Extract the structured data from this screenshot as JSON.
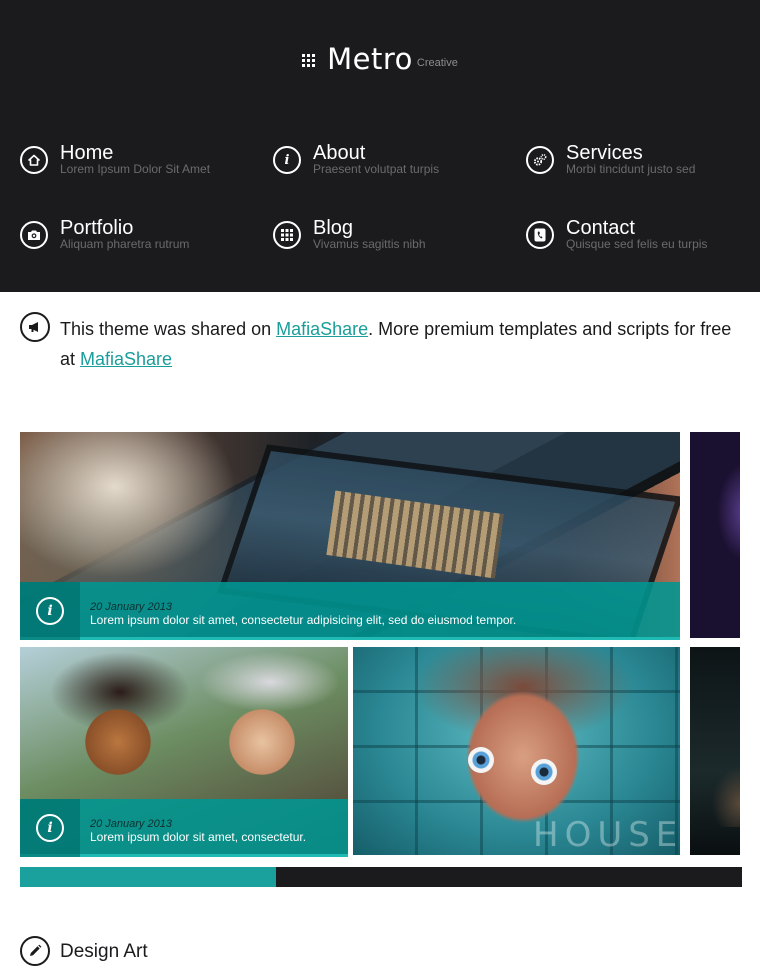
{
  "brand": {
    "title": "Metro",
    "subtitle": "Creative",
    "icon": "grid-icon"
  },
  "nav": {
    "items": [
      {
        "label": "Home",
        "desc": "Lorem Ipsum Dolor Sit Amet",
        "icon": "home-icon"
      },
      {
        "label": "About",
        "desc": "Praesent volutpat turpis",
        "icon": "info-icon"
      },
      {
        "label": "Services",
        "desc": "Morbi tincidunt justo sed",
        "icon": "gears-icon"
      },
      {
        "label": "Portfolio",
        "desc": "Aliquam pharetra rutrum",
        "icon": "camera-icon"
      },
      {
        "label": "Blog",
        "desc": "Vivamus sagittis nibh",
        "icon": "grid-icon"
      },
      {
        "label": "Contact",
        "desc": "Quisque sed felis eu turpis",
        "icon": "phone-icon"
      }
    ]
  },
  "notice": {
    "icon": "megaphone-icon",
    "text_1": "This theme was shared on ",
    "link_1": "MafiaShare",
    "text_2": ". More premium templates and scripts for free at ",
    "link_2": "MafiaShare"
  },
  "slider": {
    "tiles": [
      {
        "date": "20 January 2013",
        "text": "Lorem ipsum dolor sit amet, consectetur adipisicing elit, sed do eiusmod tempor.",
        "icon": "info-icon"
      },
      {
        "date": "20 January 2013",
        "text": "Lorem ipsum dolor sit amet, consectetur.",
        "icon": "info-icon"
      }
    ],
    "house_text": "HOUSE",
    "progress": 0.355
  },
  "section": {
    "title": "Design Art",
    "icon": "pencil-icon"
  },
  "colors": {
    "header_bg": "#1b1b1d",
    "accent": "#1aa19d",
    "link": "#1a9e9a",
    "nav_desc": "#6b6b6e"
  }
}
